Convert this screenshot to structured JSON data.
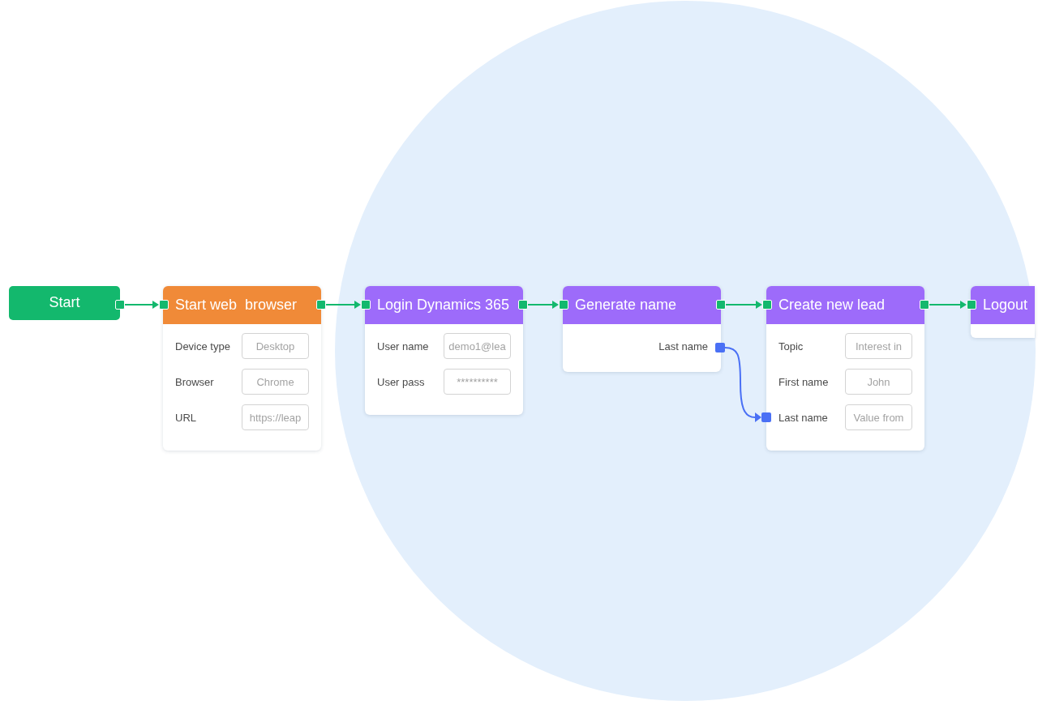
{
  "canvas": {
    "nodes": [
      {
        "kind": "start",
        "title": "Start",
        "color": "#13b86d"
      },
      {
        "kind": "action",
        "title": "Start web  browser",
        "color": "#f08a38",
        "fields": [
          {
            "kind": "input",
            "label": "Device type",
            "value": "Desktop"
          },
          {
            "kind": "input",
            "label": "Browser",
            "value": "Chrome"
          },
          {
            "kind": "input",
            "label": "URL",
            "value": "https://leap"
          }
        ]
      },
      {
        "kind": "action",
        "title": "Login Dynamics 365",
        "color": "#9d6bfa",
        "fields": [
          {
            "kind": "input",
            "label": "User name",
            "value": "demo1@lea"
          },
          {
            "kind": "input",
            "label": "User pass",
            "value": "**********"
          }
        ]
      },
      {
        "kind": "action",
        "title": "Generate name",
        "color": "#9d6bfa",
        "fields": [
          {
            "kind": "output",
            "label": "Last name"
          }
        ]
      },
      {
        "kind": "action",
        "title": "Create new lead",
        "color": "#9d6bfa",
        "fields": [
          {
            "kind": "input",
            "label": "Topic",
            "value": "Interest in"
          },
          {
            "kind": "input",
            "label": "First name",
            "value": "John"
          },
          {
            "kind": "linked",
            "label": "Last name",
            "value": "Value from"
          }
        ]
      },
      {
        "kind": "action",
        "title": "Logout",
        "color": "#9d6bfa"
      }
    ]
  }
}
